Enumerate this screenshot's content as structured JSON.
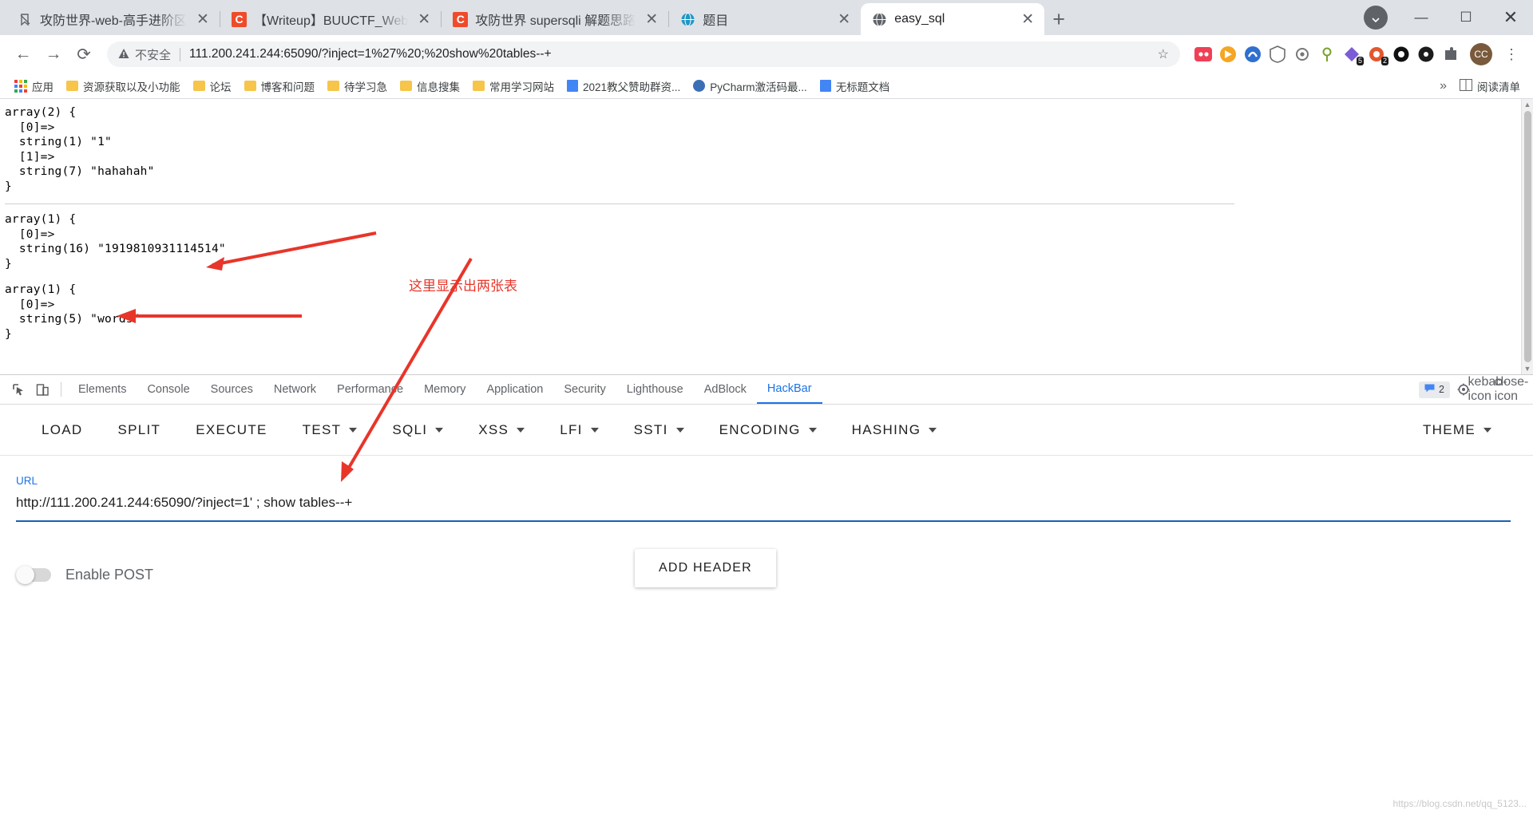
{
  "window": {
    "minimize": "—",
    "maximize": "☐",
    "close": "✕"
  },
  "tabs": [
    {
      "title": "攻防世界-web-高手进阶区",
      "favicon": "bookmark-icon",
      "close": "✕",
      "active": false
    },
    {
      "title": "【Writeup】BUUCTF_Web",
      "favicon": "csdn-icon",
      "close": "✕",
      "active": false
    },
    {
      "title": "攻防世界 supersqli 解题思路",
      "favicon": "csdn-icon",
      "close": "✕",
      "active": false
    },
    {
      "title": "题目",
      "favicon": "globe-blue-icon",
      "close": "✕",
      "active": false
    },
    {
      "title": "easy_sql",
      "favicon": "globe-gray-icon",
      "close": "✕",
      "active": true
    }
  ],
  "newtab_label": "+",
  "toolbar": {
    "back": "←",
    "forward": "→",
    "reload": "⟳",
    "warning_icon": "not-secure-triangle",
    "not_secure": "不安全",
    "url": "111.200.241.244:65090/?inject=1%27%20;%20show%20tables--+",
    "star": "☆",
    "menu": "⋮",
    "profile_initials": "CC",
    "extensions": [
      {
        "name": "extension-pocket",
        "badge": ""
      },
      {
        "name": "extension-speed",
        "badge": ""
      },
      {
        "name": "extension-blue-swirl",
        "badge": ""
      },
      {
        "name": "extension-shield",
        "badge": ""
      },
      {
        "name": "extension-gear",
        "badge": ""
      },
      {
        "name": "extension-pin",
        "badge": ""
      },
      {
        "name": "extension-diamond",
        "badge": "5"
      },
      {
        "name": "extension-adblock",
        "badge": "2"
      },
      {
        "name": "extension-circle",
        "badge": ""
      },
      {
        "name": "extension-dark-circle",
        "badge": ""
      },
      {
        "name": "extension-puzzle",
        "badge": ""
      }
    ]
  },
  "bookmarks": {
    "items": [
      {
        "label": "应用",
        "icon": "apps-icon"
      },
      {
        "label": "资源获取以及小功能",
        "icon": "folder-icon"
      },
      {
        "label": "论坛",
        "icon": "folder-icon"
      },
      {
        "label": "博客和问题",
        "icon": "folder-icon"
      },
      {
        "label": "待学习急",
        "icon": "folder-icon"
      },
      {
        "label": "信息搜集",
        "icon": "folder-icon"
      },
      {
        "label": "常用学习网站",
        "icon": "folder-icon"
      },
      {
        "label": "2021教父赞助群资...",
        "icon": "document-icon"
      },
      {
        "label": "PyCharm激活码最...",
        "icon": "globe-icon"
      },
      {
        "label": "无标题文档",
        "icon": "document-icon"
      }
    ],
    "overflow": "»",
    "reading_list": "阅读清单"
  },
  "page": {
    "dump1": "array(2) {\n  [0]=>\n  string(1) \"1\"\n  [1]=>\n  string(7) \"hahahah\"\n}",
    "dump2": "array(1) {\n  [0]=>\n  string(16) \"1919810931114514\"\n}",
    "dump3": "array(1) {\n  [0]=>\n  string(5) \"words\"\n}",
    "annotation": "这里显示出两张表",
    "annotation_color": "#e8352a",
    "scroll_up": "▲",
    "scroll_down": "▼"
  },
  "devtools": {
    "inspect_icon": "inspect-element-icon",
    "device_icon": "device-toolbar-icon",
    "tabs": [
      {
        "label": "Elements",
        "selected": false
      },
      {
        "label": "Console",
        "selected": false
      },
      {
        "label": "Sources",
        "selected": false
      },
      {
        "label": "Network",
        "selected": false
      },
      {
        "label": "Performance",
        "selected": false
      },
      {
        "label": "Memory",
        "selected": false
      },
      {
        "label": "Application",
        "selected": false
      },
      {
        "label": "Security",
        "selected": false
      },
      {
        "label": "Lighthouse",
        "selected": false
      },
      {
        "label": "AdBlock",
        "selected": false
      },
      {
        "label": "HackBar",
        "selected": true
      }
    ],
    "message_count": "2",
    "settings_icon": "gear-icon",
    "more_icon": "kebab-icon",
    "close_icon": "close-icon",
    "accent": "#1a73e8"
  },
  "hackbar": {
    "buttons": [
      {
        "label": "LOAD",
        "dropdown": false
      },
      {
        "label": "SPLIT",
        "dropdown": false
      },
      {
        "label": "EXECUTE",
        "dropdown": false
      },
      {
        "label": "TEST",
        "dropdown": true
      },
      {
        "label": "SQLI",
        "dropdown": true
      },
      {
        "label": "XSS",
        "dropdown": true
      },
      {
        "label": "LFI",
        "dropdown": true
      },
      {
        "label": "SSTI",
        "dropdown": true
      },
      {
        "label": "ENCODING",
        "dropdown": true
      },
      {
        "label": "HASHING",
        "dropdown": true
      }
    ],
    "theme_button": {
      "label": "THEME",
      "dropdown": true
    },
    "url_label": "URL",
    "url_value": "http://111.200.241.244:65090/?inject=1' ; show tables--+",
    "enable_post_label": "Enable POST",
    "enable_post_on": false,
    "add_header_label": "ADD HEADER"
  },
  "watermark": "https://blog.csdn.net/qq_5123..."
}
